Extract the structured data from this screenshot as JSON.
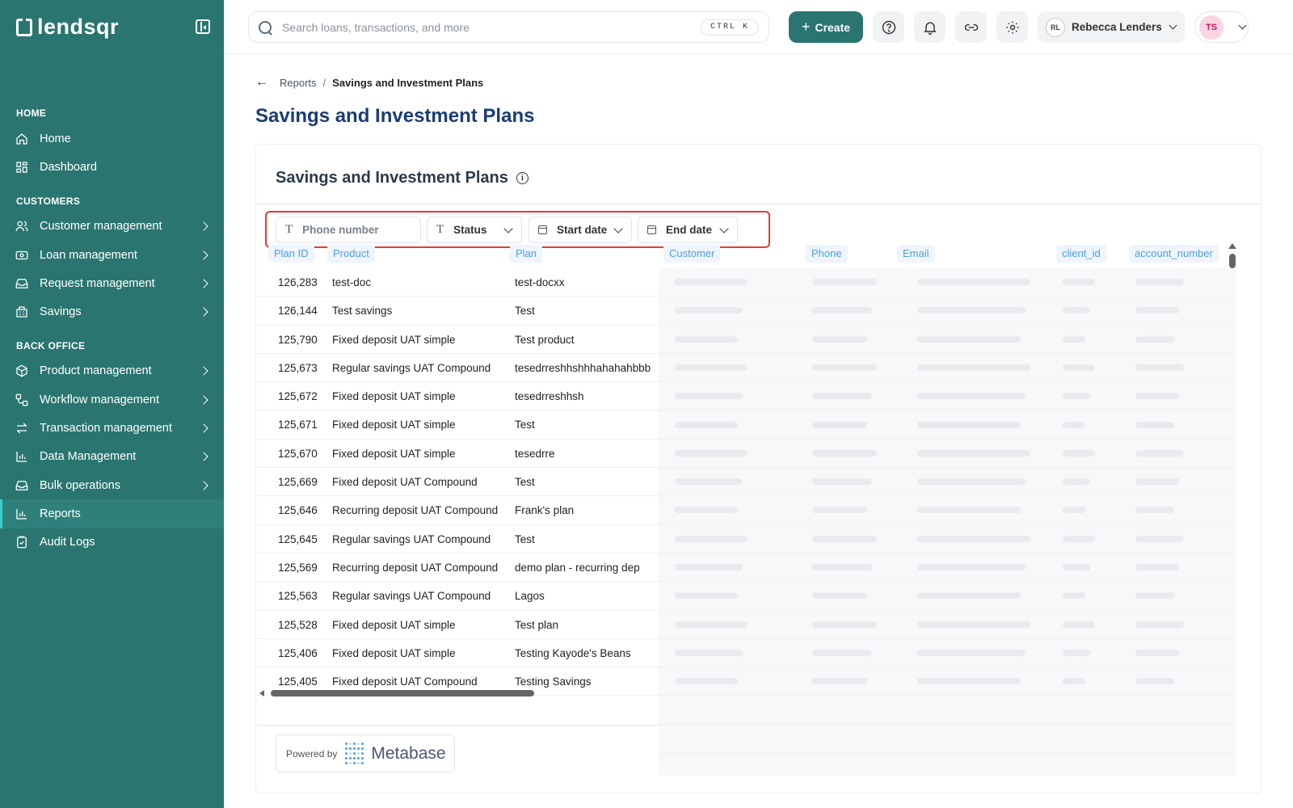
{
  "brand": {
    "logo_text": "lendsqr"
  },
  "sidebar": {
    "sections": [
      {
        "title": "HOME",
        "items": [
          {
            "label": "Home",
            "icon": "home-icon",
            "chevron": false
          },
          {
            "label": "Dashboard",
            "icon": "dashboard-icon",
            "chevron": false
          }
        ]
      },
      {
        "title": "CUSTOMERS",
        "items": [
          {
            "label": "Customer management",
            "icon": "users-icon",
            "chevron": true
          },
          {
            "label": "Loan management",
            "icon": "money-icon",
            "chevron": true
          },
          {
            "label": "Request management",
            "icon": "inbox-icon",
            "chevron": true
          },
          {
            "label": "Savings",
            "icon": "piggy-bank-icon",
            "chevron": true
          }
        ]
      },
      {
        "title": "BACK OFFICE",
        "items": [
          {
            "label": "Product management",
            "icon": "box-icon",
            "chevron": true
          },
          {
            "label": "Workflow management",
            "icon": "workflow-icon",
            "chevron": true
          },
          {
            "label": "Transaction management",
            "icon": "arrows-icon",
            "chevron": true
          },
          {
            "label": "Data Management",
            "icon": "bar-chart-icon",
            "chevron": true
          },
          {
            "label": "Bulk operations",
            "icon": "inbox-icon",
            "chevron": true
          },
          {
            "label": "Reports",
            "icon": "bar-chart-icon",
            "chevron": false,
            "active": true
          },
          {
            "label": "Audit Logs",
            "icon": "clipboard-icon",
            "chevron": false
          }
        ]
      }
    ]
  },
  "topbar": {
    "search_placeholder": "Search loans, transactions, and more",
    "shortcut": "CTRL K",
    "create_label": "Create",
    "user_initials": "RL",
    "user_name": "Rebecca Lenders",
    "profile_initials": "TS"
  },
  "breadcrumb": {
    "parent": "Reports",
    "separator": "/",
    "current": "Savings and Investment Plans"
  },
  "page_title": "Savings and Investment Plans",
  "card": {
    "title": "Savings and Investment Plans",
    "filters": {
      "phone_placeholder": "Phone number",
      "status": "Status",
      "start_date": "Start date",
      "end_date": "End date"
    },
    "columns": [
      "Plan ID",
      "Product",
      "Plan",
      "Customer",
      "Phone",
      "Email",
      "client_id",
      "account_number"
    ],
    "rows": [
      {
        "id": "126,283",
        "product": "test-doc",
        "plan": "test-docxx"
      },
      {
        "id": "126,144",
        "product": "Test savings",
        "plan": "Test"
      },
      {
        "id": "125,790",
        "product": "Fixed deposit UAT simple",
        "plan": "Test product"
      },
      {
        "id": "125,673",
        "product": "Regular savings UAT Compound",
        "plan": "tesedrreshhshhhahahahbbb"
      },
      {
        "id": "125,672",
        "product": "Fixed deposit UAT simple",
        "plan": "tesedrreshhsh"
      },
      {
        "id": "125,671",
        "product": "Fixed deposit UAT simple",
        "plan": "Test"
      },
      {
        "id": "125,670",
        "product": "Fixed deposit UAT simple",
        "plan": "tesedrre"
      },
      {
        "id": "125,669",
        "product": "Fixed deposit UAT Compound",
        "plan": "Test"
      },
      {
        "id": "125,646",
        "product": "Recurring deposit UAT Compound",
        "plan": "Frank's plan"
      },
      {
        "id": "125,645",
        "product": "Regular savings UAT Compound",
        "plan": "Test"
      },
      {
        "id": "125,569",
        "product": "Recurring deposit UAT Compound",
        "plan": "demo plan - recurring dep"
      },
      {
        "id": "125,563",
        "product": "Regular savings UAT Compound",
        "plan": "Lagos"
      },
      {
        "id": "125,528",
        "product": "Fixed deposit UAT simple",
        "plan": "Test plan"
      },
      {
        "id": "125,406",
        "product": "Fixed deposit UAT simple",
        "plan": "Testing Kayode's Beans"
      },
      {
        "id": "125,405",
        "product": "Fixed deposit UAT Compound",
        "plan": "Testing Savings"
      }
    ],
    "powered_by_label": "Powered by",
    "powered_by_brand": "Metabase"
  },
  "colors": {
    "sidebar_bg": "#2a7570",
    "accent": "#39cdcc",
    "title": "#1c3c78",
    "metabase_blue": "#509ee3",
    "highlight_red": "#e53935"
  }
}
